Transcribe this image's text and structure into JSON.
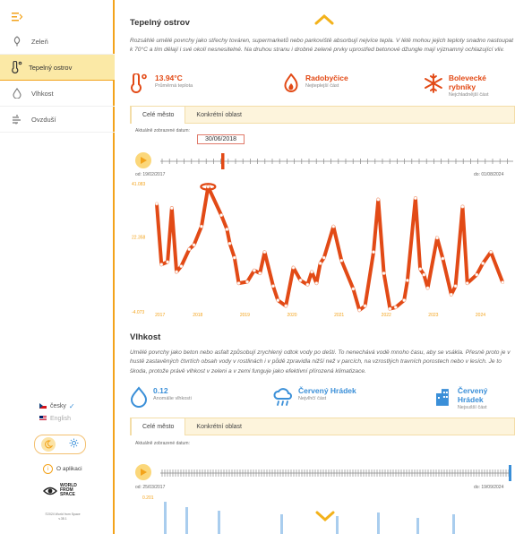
{
  "sidebar": {
    "items": [
      {
        "label": "Zeleň",
        "icon": "tree-icon"
      },
      {
        "label": "Tepelný ostrov",
        "icon": "thermometer-icon"
      },
      {
        "label": "Vlhkost",
        "icon": "drop-icon"
      },
      {
        "label": "Ovzduší",
        "icon": "wind-icon"
      }
    ],
    "languages": [
      {
        "label": "česky",
        "selected": true
      },
      {
        "label": "English",
        "selected": false
      }
    ],
    "about_label": "O aplikaci",
    "logo_text": [
      "WORLD",
      "FROM",
      "SPACE"
    ],
    "copyright": [
      "©2024 World from Space",
      "v.38.1"
    ]
  },
  "heat": {
    "title": "Tepelný ostrov",
    "description": "Rozsáhlé umělé povrchy jako střechy továren, supermarketů nebo parkoviště absorbují nejvíce tepla. V létě mohou jejich teploty snadno nastoupat k 70°C a tím dělají i své okolí nesnesitelné. Na druhou stranu i drobné zelené prvky uprostřed betonové džungle mají významný ochlazující vliv.",
    "stats": [
      {
        "value": "13.94°C",
        "label": "Průměrná teplota",
        "icon": "thermometer-icon"
      },
      {
        "value": "Radobyčice",
        "label": "Nejteplejší část",
        "icon": "flame-icon"
      },
      {
        "value": "Bolevecké rybníky",
        "label": "Nejchladnější část",
        "icon": "snowflake-icon"
      }
    ],
    "tabs": [
      "Celé město",
      "Konkrétní oblast"
    ],
    "date_label": "Aktuálně zobrazené datum:",
    "current_date": "30/06/2018",
    "from_label": "od: 19/02/2017",
    "to_label": "do: 01/08/2024"
  },
  "humidity": {
    "title": "Vlhkost",
    "description": "Umělé povrchy jako beton nebo asfalt způsobují zrychlený odtok vody po dešti. To nenechává vodě mnoho času, aby se vsákla. Přesně proto je v hustě zastavěných čtvrtích obsah vody v rostlinách i v půdě zpravidla nižší než v parcích, na vzrostlých travních porostech nebo v lesích. Je to škoda, protože právě vlhkost v zeleni a v zemi funguje jako efektivní přirozená klimatizace.",
    "stats": [
      {
        "value": "0.12",
        "label": "Anomálie vlhkosti",
        "icon": "drop-icon"
      },
      {
        "value": "Červený Hrádek",
        "label": "Nejvlhčí část",
        "icon": "rain-cloud-icon"
      },
      {
        "value": "Červený Hrádek",
        "label": "Nejsušší část",
        "icon": "building-icon"
      }
    ],
    "tabs": [
      "Celé město",
      "Konkrétní oblast"
    ],
    "date_label": "Aktuálně zobrazené datum:",
    "from_label": "od: 25/03/2017",
    "to_label": "do: 19/09/2024",
    "y_top": "0.201"
  },
  "colors": {
    "accent": "#f3a31b",
    "heat": "#e24a16",
    "blue": "#3a8fd8",
    "tab_bg": "#fdf4dc"
  },
  "chart_data": {
    "type": "line",
    "x_labels": [
      "2017",
      "2018",
      "2019",
      "2020",
      "2021",
      "2022",
      "2023",
      "2024"
    ],
    "y_tick_labels": [
      "41.083",
      "22.358",
      "-4.073"
    ],
    "ylim": [
      -4.073,
      41.083
    ],
    "x_range": [
      2017.13,
      2024.58
    ],
    "series": [
      {
        "x": [
          2017.13,
          2017.23,
          2017.36,
          2017.45,
          2017.55,
          2017.65,
          2017.82,
          2017.92,
          2018.08,
          2018.22,
          2018.5,
          2018.62,
          2018.68,
          2018.78,
          2018.87,
          2019.05,
          2019.2,
          2019.32,
          2019.42,
          2019.6,
          2019.7,
          2019.87,
          2020.03,
          2020.18,
          2020.33,
          2020.42,
          2020.52,
          2020.6,
          2020.68,
          2020.88,
          2021.05,
          2021.3,
          2021.43,
          2021.55,
          2021.73,
          2021.83,
          2021.95,
          2022.08,
          2022.2,
          2022.38,
          2022.45,
          2022.62,
          2022.72,
          2022.8,
          2022.88,
          2023.08,
          2023.2,
          2023.38,
          2023.47,
          2023.62,
          2023.72,
          2023.92,
          2024.05,
          2024.22,
          2024.47
        ],
        "y": [
          34,
          12.6,
          13.5,
          32.5,
          10,
          12,
          18,
          19.5,
          26,
          40,
          30,
          25,
          20,
          15,
          6,
          6.5,
          10.5,
          9.5,
          17,
          5,
          0,
          -2,
          11.5,
          7,
          5.5,
          10,
          6,
          13,
          15,
          26,
          14,
          4,
          -3.5,
          -2,
          17,
          35.5,
          9.5,
          -3,
          -2.5,
          0,
          7,
          36,
          11,
          9,
          4.3,
          22,
          14.7,
          2,
          5,
          33,
          6,
          9,
          13,
          17,
          6.3
        ]
      }
    ]
  }
}
